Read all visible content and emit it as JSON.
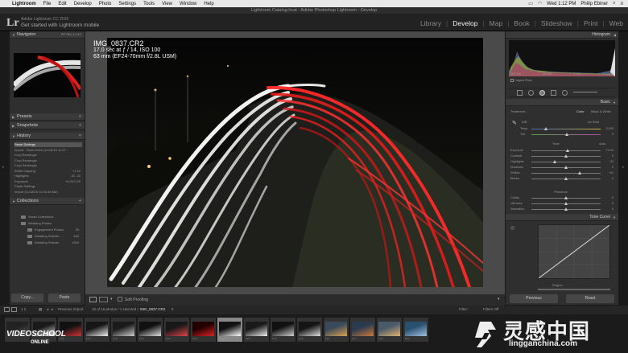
{
  "menubar": {
    "apple": "",
    "app": "Lightroom",
    "items": [
      "File",
      "Edit",
      "Develop",
      "Photo",
      "Settings",
      "Tools",
      "View",
      "Window",
      "Help"
    ],
    "clock": "Wed 1:12 PM",
    "user": "Philip Ebiner"
  },
  "window": {
    "title": "Lightroom Catalog.lrcat - Adobe Photoshop Lightroom - Develop"
  },
  "identity": {
    "logo": "Lr",
    "line1": "Adobe Lightroom CC 2015",
    "line2": "Get started with Lightroom mobile"
  },
  "modules": {
    "items": [
      "Library",
      "Develop",
      "Map",
      "Book",
      "Slideshow",
      "Print",
      "Web"
    ],
    "active": "Develop",
    "separator": "|"
  },
  "left": {
    "navigator": {
      "title": "Navigator",
      "zoom": "FIT  FILL  1:1  3:1"
    },
    "presets": {
      "title": "Presets"
    },
    "snapshots": {
      "title": "Snapshots"
    },
    "history": {
      "title": "History",
      "items": [
        {
          "label": "Reset Settings",
          "value": ""
        },
        {
          "label": "Import - Flash Drive (11/18/15 11:27...",
          "value": ""
        },
        {
          "label": "Crop Rectangle",
          "value": ""
        },
        {
          "label": "Crop Rectangle",
          "value": ""
        },
        {
          "label": "Crop Rectangle",
          "value": ""
        },
        {
          "label": "White Clipping",
          "value": "+1   41"
        },
        {
          "label": "Highlights",
          "value": "-32   -32"
        },
        {
          "label": "Exposure",
          "value": "+0.29  0.29"
        },
        {
          "label": "Paste Settings",
          "value": ""
        },
        {
          "label": "Import (11/18/15 11:26:49 AM)",
          "value": ""
        }
      ]
    },
    "collections": {
      "title": "Collections",
      "items": [
        {
          "label": "Smart Collections",
          "count": ""
        },
        {
          "label": "Wedding Photos",
          "count": ""
        },
        {
          "label": "Engagement Photos",
          "count": "25"
        },
        {
          "label": "Wedding Selects ...",
          "count": "182"
        },
        {
          "label": "Wedding Selects",
          "count": "1934"
        }
      ]
    },
    "copy_label": "Copy...",
    "paste_label": "Paste"
  },
  "photo": {
    "filename": "IMG_0837.CR2",
    "exposure": "17.0 sec at ƒ / 14, ISO 100",
    "lens": "63 mm (EF24-70mm f/2.8L USM)"
  },
  "toolbar": {
    "soft_proofing": "Soft Proofing"
  },
  "right": {
    "histogram": {
      "title": "Histogram",
      "iso": "ISO 100",
      "focal": "63 mm",
      "aperture": "ƒ / 14",
      "shutter": "17.0 sec",
      "original": "Original Photo"
    },
    "basic": {
      "title": "Basic",
      "treatment_label": "Treatment :",
      "color_label": "Color",
      "bw_label": "Black & White",
      "wb_label": "WB :",
      "wb_value": "As Shot",
      "temp_label": "Temp",
      "temp_value": "3,200",
      "tint_label": "Tint",
      "tint_value": "0",
      "tone_label": "Tone",
      "auto_label": "Auto",
      "sliders": [
        {
          "label": "Exposure",
          "value": "+0.29",
          "pos": 0.52
        },
        {
          "label": "Contrast",
          "value": "0",
          "pos": 0.5
        },
        {
          "label": "Highlights",
          "value": "-32",
          "pos": 0.34
        },
        {
          "label": "Shadows",
          "value": "0",
          "pos": 0.5
        },
        {
          "label": "Whites",
          "value": "+41",
          "pos": 0.7
        },
        {
          "label": "Blacks",
          "value": "0",
          "pos": 0.5
        }
      ],
      "presence_label": "Presence",
      "presence": [
        {
          "label": "Clarity",
          "value": "0",
          "pos": 0.5
        },
        {
          "label": "Vibrance",
          "value": "0",
          "pos": 0.5
        },
        {
          "label": "Saturation",
          "value": "0",
          "pos": 0.5
        }
      ]
    },
    "tone_curve": {
      "title": "Tone Curve",
      "region": "Region"
    },
    "previous_label": "Previous",
    "reset_label": "Reset"
  },
  "filmstrip": {
    "pages": "1  2",
    "source": "Previous Import",
    "count_text": "16 of 16 photos / 1 selected /",
    "selected_file": "IMG_0837.CR2",
    "filter": "Filter :",
    "filter_value": "Filters Off",
    "selected_index": 8,
    "ratings": [
      "",
      "",
      "***",
      "***",
      "***",
      "***",
      "***",
      "***",
      "*****",
      "***",
      "***",
      "***",
      "***",
      "***",
      "***",
      "***"
    ]
  },
  "watermarks": {
    "videoschool": "VIDEOSCHOOL",
    "online": "ONLINE",
    "cn": "灵感中国",
    "site": "lingganchina.com"
  }
}
